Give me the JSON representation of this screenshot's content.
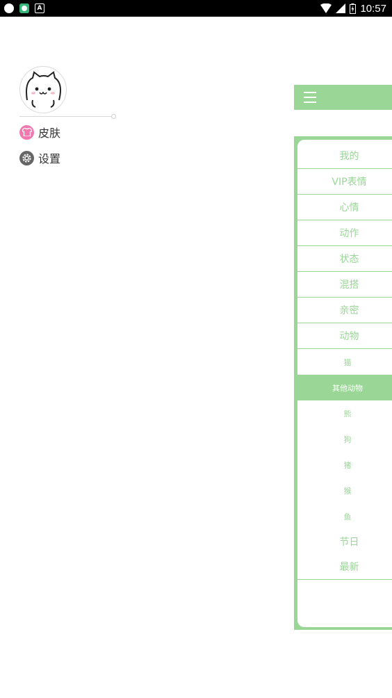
{
  "status_bar": {
    "time": "10:57"
  },
  "drawer": {
    "menu": [
      {
        "label": "皮肤",
        "icon": "skin-shirt-icon",
        "color": "#f07ab0"
      },
      {
        "label": "设置",
        "icon": "gear-icon",
        "color": "#666666"
      }
    ]
  },
  "toolbar": {
    "menu_icon": "hamburger-icon",
    "color": "#9ad797"
  },
  "categories": {
    "main": [
      "我的",
      "VIP表情",
      "心情",
      "动作",
      "状态",
      "混搭",
      "亲密",
      "动物"
    ],
    "animal_subs": [
      "猫",
      "其他动物",
      "熊",
      "狗",
      "猪",
      "猴",
      "鱼"
    ],
    "active_sub": "其他动物",
    "tail": [
      "节日",
      "最新"
    ]
  }
}
